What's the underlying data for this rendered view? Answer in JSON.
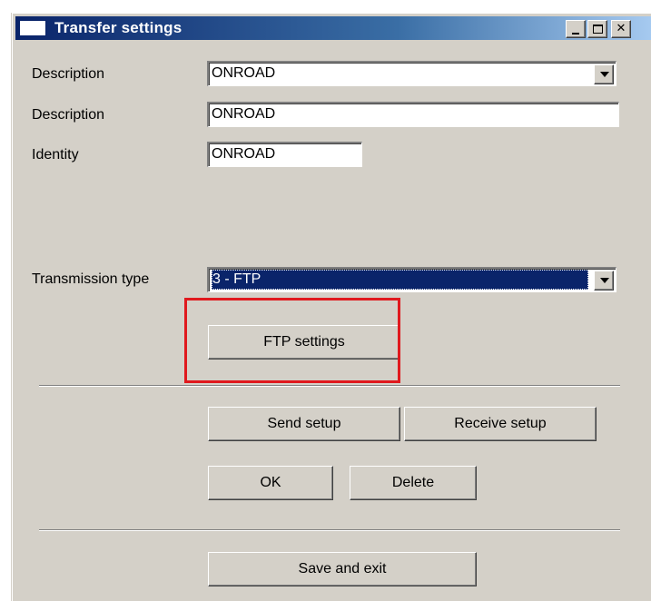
{
  "window": {
    "title": "Transfer settings"
  },
  "form": {
    "description_dropdown": {
      "label": "Description",
      "value": "ONROAD"
    },
    "description_text": {
      "label": "Description",
      "value": "ONROAD"
    },
    "identity": {
      "label": "Identity",
      "value": "ONROAD"
    },
    "transmission_type": {
      "label": "Transmission type",
      "value": "3 - FTP"
    }
  },
  "buttons": {
    "ftp_settings": "FTP settings",
    "send_setup": "Send setup",
    "receive_setup": "Receive setup",
    "ok": "OK",
    "delete": "Delete",
    "save_and_exit": "Save and exit"
  },
  "colors": {
    "window_bg": "#d4d0c8",
    "titlebar_start": "#0a246a",
    "titlebar_end": "#a6caf0",
    "selection_bg": "#0a246a",
    "highlight_box": "#e0191e"
  },
  "icons": {
    "title": "window-icon",
    "minimize": "minimize-icon",
    "maximize": "maximize-icon",
    "close": "close-icon",
    "dropdown": "chevron-down-icon"
  }
}
